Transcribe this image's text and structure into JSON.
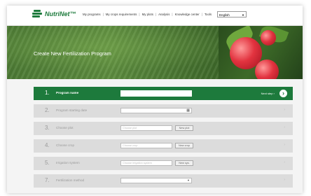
{
  "header": {
    "logo_text": "NutriNet™",
    "nav": [
      "My programs",
      "My crops requirements",
      "My plots",
      "Analysis",
      "Knowledge center",
      "Tools"
    ],
    "language": "English"
  },
  "hero": {
    "title": "Create New Fertilization Program"
  },
  "steps": [
    {
      "num": "1.",
      "label": "Program name",
      "next": "Next step ›",
      "active": true
    },
    {
      "num": "2.",
      "label": "Program starting date"
    },
    {
      "num": "3.",
      "label": "Choose plot",
      "placeholder": "Choose plot",
      "button": "New plot"
    },
    {
      "num": "4.",
      "label": "Choose crop",
      "placeholder": "Choose crop",
      "button": "New crop"
    },
    {
      "num": "5.",
      "label": "Irrigation system",
      "placeholder": "Choose irrigation system",
      "button": "New sys."
    },
    {
      "num": "7.",
      "label": "Fertilization method"
    }
  ],
  "colors": {
    "brand_green": "#1d7a3c",
    "step_inactive": "#dcdcdc"
  }
}
